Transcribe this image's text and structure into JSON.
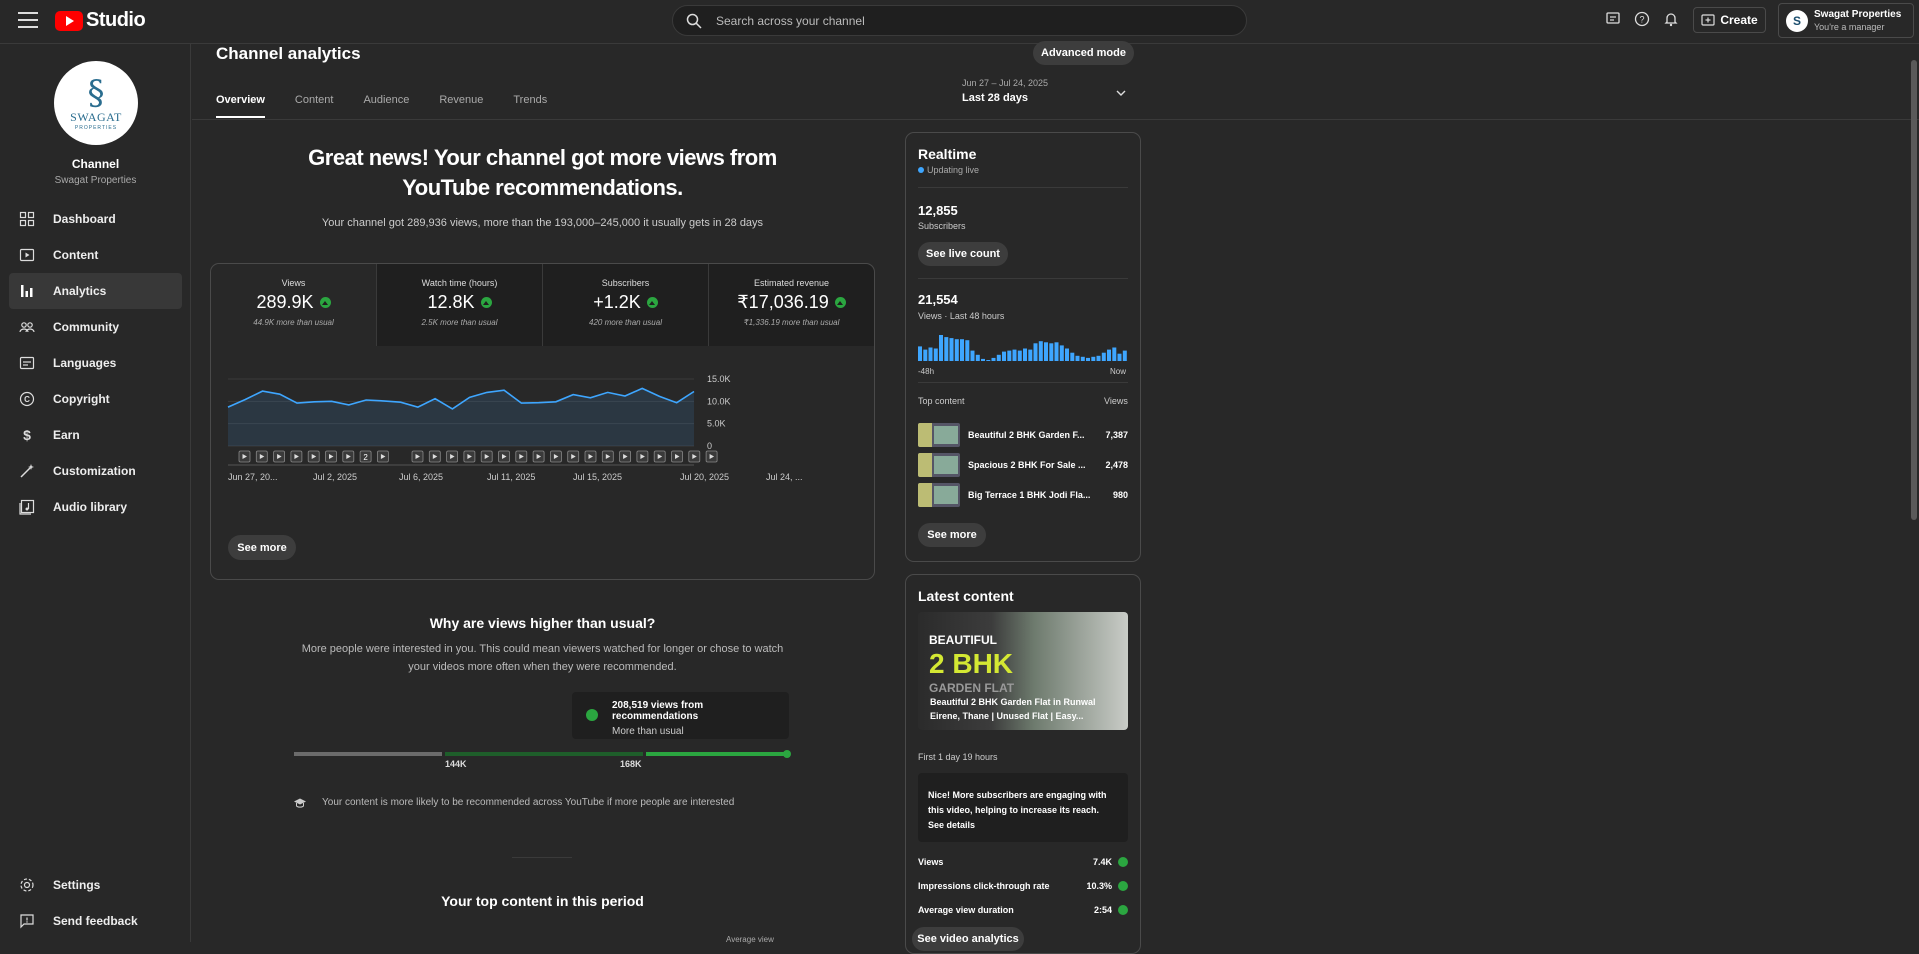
{
  "app": {
    "logo_text": "Studio"
  },
  "search": {
    "placeholder": "Search across your channel"
  },
  "header": {
    "create_label": "Create",
    "account_name": "Swagat Properties",
    "account_role": "You're a manager"
  },
  "sidebar": {
    "logo_text": "SWAGAT",
    "logo_sub": "PROPERTIES",
    "title": "Channel",
    "subtitle": "Swagat Properties",
    "items": [
      {
        "label": "Dashboard",
        "icon": "dashboard-icon"
      },
      {
        "label": "Content",
        "icon": "content-icon"
      },
      {
        "label": "Analytics",
        "icon": "analytics-icon"
      },
      {
        "label": "Community",
        "icon": "community-icon"
      },
      {
        "label": "Languages",
        "icon": "languages-icon"
      },
      {
        "label": "Copyright",
        "icon": "copyright-icon"
      },
      {
        "label": "Earn",
        "icon": "earn-icon"
      },
      {
        "label": "Customization",
        "icon": "customization-icon"
      },
      {
        "label": "Audio library",
        "icon": "audio-library-icon"
      }
    ],
    "bottom": [
      {
        "label": "Settings",
        "icon": "gear-icon"
      },
      {
        "label": "Send feedback",
        "icon": "feedback-icon"
      }
    ]
  },
  "page": {
    "title": "Channel analytics",
    "advanced_mode": "Advanced mode",
    "tabs": [
      "Overview",
      "Content",
      "Audience",
      "Revenue",
      "Trends"
    ],
    "date_range": "Jun 27 – Jul 24, 2025",
    "period": "Last 28 days"
  },
  "overview": {
    "headline": "Great news! Your channel got more views from YouTube recommendations.",
    "subline": "Your channel got 289,936 views, more than the 193,000–245,000 it usually gets in 28 days",
    "metrics": [
      {
        "label": "Views",
        "value": "289.9K",
        "note": "44.9K more than usual"
      },
      {
        "label": "Watch time (hours)",
        "value": "12.8K",
        "note": "2.5K more than usual"
      },
      {
        "label": "Subscribers",
        "value": "+1.2K",
        "note": "420 more than usual"
      },
      {
        "label": "Estimated revenue",
        "value": "₹17,036.19",
        "note": "₹1,336.19 more than usual"
      }
    ],
    "see_more": "See more"
  },
  "chart_data": {
    "type": "area",
    "x_tick_labels": [
      "Jun 27, 20...",
      "Jul 2, 2025",
      "Jul 6, 2025",
      "Jul 11, 2025",
      "Jul 15, 2025",
      "Jul 20, 2025",
      "Jul 24, ..."
    ],
    "y_tick_labels": [
      "15.0K",
      "10.0K",
      "5.0K",
      "0"
    ],
    "ylim": [
      0,
      15000
    ],
    "values": [
      8700,
      10400,
      12300,
      11600,
      9600,
      9900,
      10000,
      9200,
      10300,
      10100,
      9800,
      8700,
      10600,
      8300,
      10900,
      12000,
      12500,
      9600,
      9700,
      9900,
      11500,
      10800,
      12000,
      11200,
      12900,
      11100,
      9700,
      12200
    ],
    "video_markers": 28,
    "marker_badge": "2"
  },
  "why": {
    "title": "Why are views higher than usual?",
    "text": "More people were interested in you. This could mean viewers watched for longer or chose to watch your videos more often when they were recommended.",
    "tooltip_title": "208,519 views from recommendations",
    "tooltip_sub": "More than usual",
    "range_low": "144K",
    "range_high": "168K",
    "hint": "Your content is more likely to be recommended across YouTube if more people are interested",
    "top_content_title": "Your top content in this period",
    "avg_view_label": "Average view"
  },
  "realtime": {
    "title": "Realtime",
    "live": "Updating live",
    "subscribers": "12,855",
    "subscribers_label": "Subscribers",
    "live_count_btn": "See live count",
    "views": "21,554",
    "views_label": "Views · Last 48 hours",
    "axis_start": "-48h",
    "axis_end": "Now",
    "hourly_views": [
      14,
      11,
      13,
      12,
      25,
      23,
      22,
      21,
      21,
      20,
      10,
      6,
      2,
      1,
      3,
      6,
      9,
      10,
      11,
      10,
      12,
      11,
      17,
      19,
      18,
      17,
      18,
      15,
      12,
      8,
      5,
      4,
      3,
      4,
      5,
      8,
      11,
      13,
      7,
      10
    ],
    "top_content_label": "Top content",
    "views_col": "Views",
    "top_content": [
      {
        "title": "Beautiful 2 BHK Garden F...",
        "views": "7,387"
      },
      {
        "title": "Spacious 2 BHK For Sale ...",
        "views": "2,478"
      },
      {
        "title": "Big Terrace 1 BHK Jodi Fla...",
        "views": "980"
      }
    ],
    "see_more": "See more"
  },
  "latest": {
    "title": "Latest content",
    "thumb_line1": "BEAUTIFUL",
    "thumb_line2": "2 BHK",
    "thumb_line3": "GARDEN FLAT",
    "caption": "Beautiful 2 BHK Garden Flat in Runwal Eirene, Thane | Unused Flat | Easy...",
    "age": "First 1 day 19 hours",
    "insight": "Nice! More subscribers are engaging with this video, helping to increase its reach.",
    "insight_link": "See details",
    "stats": [
      {
        "label": "Views",
        "value": "7.4K"
      },
      {
        "label": "Impressions click-through rate",
        "value": "10.3%"
      },
      {
        "label": "Average view duration",
        "value": "2:54"
      }
    ],
    "analytics_btn": "See video analytics"
  },
  "colors": {
    "accent_line": "#3ea6ff",
    "up_green": "#2ba640",
    "yt_red": "#ff0000"
  }
}
